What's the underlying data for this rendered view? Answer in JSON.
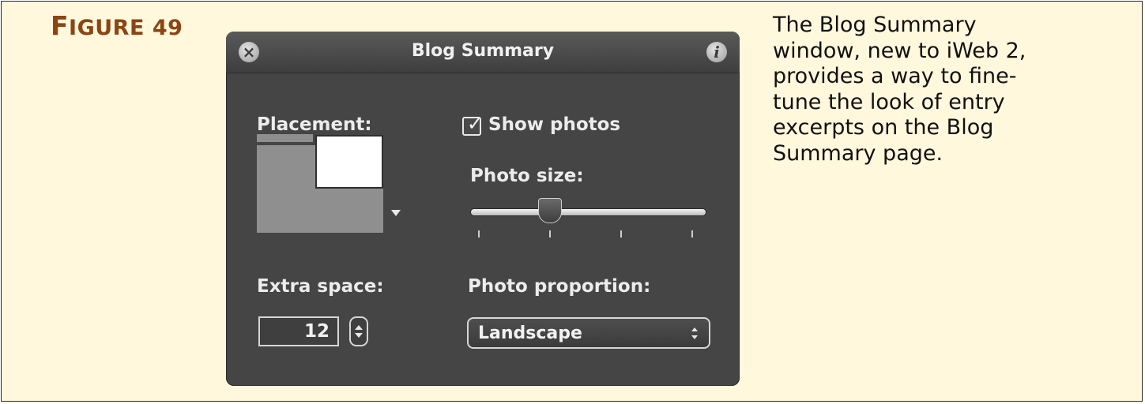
{
  "figure": {
    "label_first": "F",
    "label_rest": "IGURE 49",
    "caption": "The Blog Summary window, new to iWeb 2, provides a way to fine-tune the look of entry excerpts on the Blog Summary page."
  },
  "panel": {
    "title": "Blog Summary",
    "close_icon": "close-icon",
    "info_icon": "info-icon",
    "placement_label": "Placement:",
    "show_photos_label": "Show photos",
    "show_photos_checked": true,
    "photo_size_label": "Photo size:",
    "photo_size_ticks": 4,
    "photo_size_value": 0.35,
    "extra_space_label": "Extra space:",
    "extra_space_value": "12",
    "photo_proportion_label": "Photo proportion:",
    "photo_proportion_value": "Landscape"
  },
  "colors": {
    "figure_label": "#8b4513",
    "figure_background": "#fff8dc",
    "panel_background": "#454545"
  }
}
